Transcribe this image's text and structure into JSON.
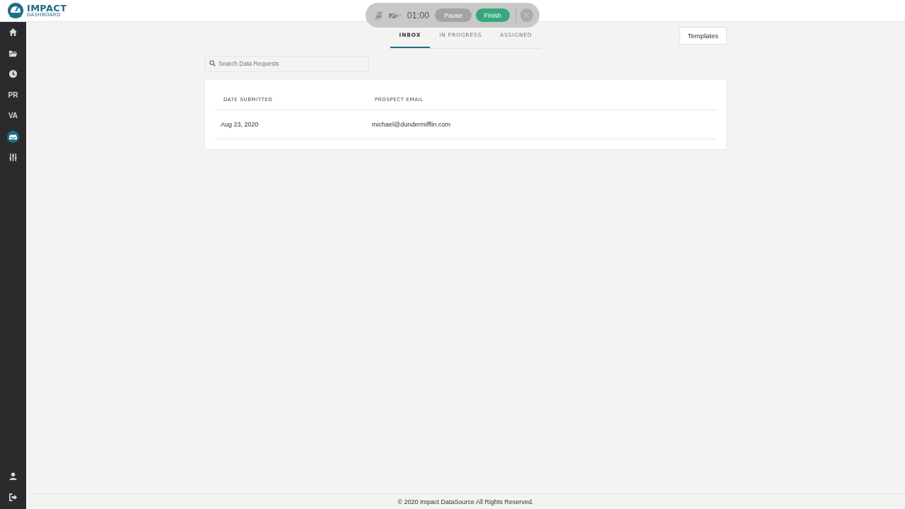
{
  "logo": {
    "title": "IMPACT",
    "subtitle": "DASHBOARD"
  },
  "recorder": {
    "timer": "01:00",
    "pause": "Pause",
    "finish": "Finish"
  },
  "sidebar": {
    "items": [
      {
        "kind": "home",
        "selected": false
      },
      {
        "kind": "folder",
        "selected": false
      },
      {
        "kind": "clock",
        "selected": false
      },
      {
        "kind": "text",
        "label": "PR",
        "selected": false
      },
      {
        "kind": "text",
        "label": "VA",
        "selected": false
      },
      {
        "kind": "inbox",
        "selected": true
      },
      {
        "kind": "sliders",
        "selected": false
      }
    ],
    "bottom_items": [
      {
        "kind": "user"
      },
      {
        "kind": "logout"
      }
    ]
  },
  "tabs": [
    {
      "label": "INBOX",
      "selected": true
    },
    {
      "label": "IN PROGRESS",
      "selected": false
    },
    {
      "label": "ASSIGNED",
      "selected": false
    }
  ],
  "templates_button": "Templates",
  "search": {
    "placeholder": "Search Data Requests"
  },
  "table": {
    "columns": [
      "DATE SUBMITTED",
      "PROSPECT EMAIL"
    ],
    "rows": [
      [
        "Aug 23, 2020",
        "michael@dundermifflin.com"
      ]
    ]
  },
  "footer": "© 2020 Impact DataSource All Rights Reserved."
}
